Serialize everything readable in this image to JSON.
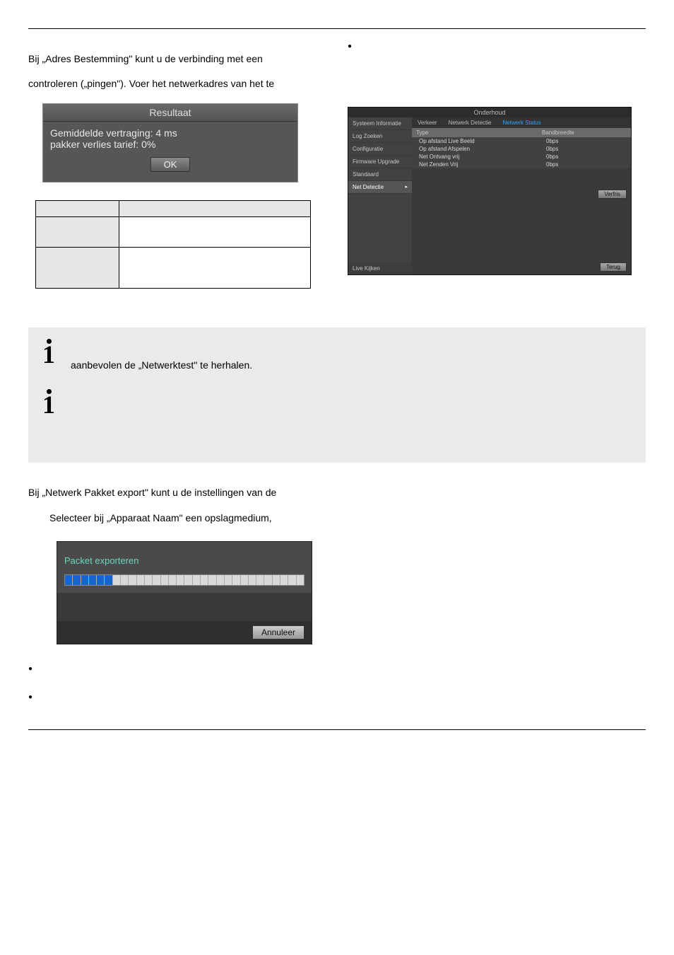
{
  "intro": {
    "line1": "Bij „Adres Bestemming\" kunt u de verbinding met een",
    "line2": "controleren („pingen\"). Voer het netwerkadres van het te"
  },
  "result_dialog": {
    "title": "Resultaat",
    "body_line1": "Gemiddelde vertraging: 4 ms",
    "body_line2": "pakker verlies tarief: 0%",
    "ok": "OK"
  },
  "net_panel": {
    "title": "Onderhoud",
    "sidebar": {
      "items": [
        {
          "label": "Systeem Informatie"
        },
        {
          "label": "Log Zoeken"
        },
        {
          "label": "Configuratie"
        },
        {
          "label": "Firmware Upgrade"
        },
        {
          "label": "Standaard"
        },
        {
          "label": "Net Detectie"
        }
      ],
      "bottom": "Live Kijken"
    },
    "tabs": {
      "t1": "Verkeer",
      "t2": "Netwerk Detectie",
      "t3": "Netwerk Status"
    },
    "headers": {
      "h1": "Type",
      "h2": "Bandbreedte"
    },
    "rows": [
      {
        "c1": "Op afstand Live Beeld",
        "c2": "0bps"
      },
      {
        "c1": "Op afstand Afspelen",
        "c2": "0bps"
      },
      {
        "c1": "Net Ontvang vrij",
        "c2": "0bps"
      },
      {
        "c1": "Net Zenden Vrij",
        "c2": "0bps"
      }
    ],
    "buttons": {
      "refresh": "Verfris",
      "back": "Terug"
    }
  },
  "info": {
    "text1": "aanbevolen de „Netwerktest\" te herhalen."
  },
  "section2": {
    "line1": "Bij „Netwerk Pakket export\" kunt u de instellingen van de",
    "line2": "Selecteer bij „Apparaat Naam\" een opslagmedium,"
  },
  "packet": {
    "title": "Packet exporteren",
    "cancel": "Annuleer"
  }
}
